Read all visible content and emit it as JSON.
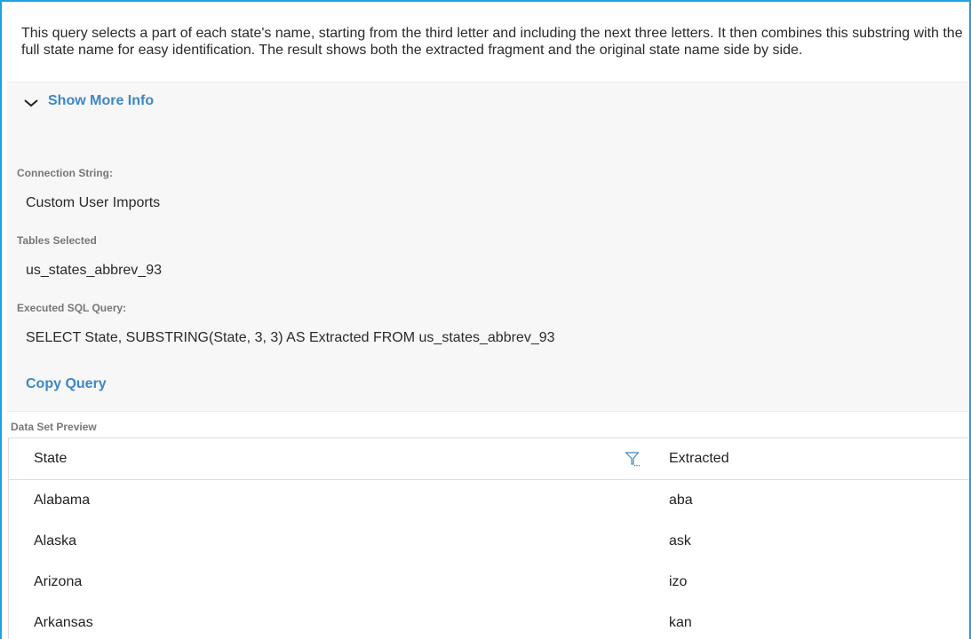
{
  "description": "This query selects a part of each state's name, starting from the third letter and including the next three letters. It then combines this substring with the full state name for easy identification. The result shows both the extracted fragment and the original state name side by side.",
  "info": {
    "toggle_label": "Show More Info",
    "connection_label": "Connection String:",
    "connection_value": "Custom User Imports",
    "tables_label": "Tables Selected",
    "tables_value": "us_states_abbrev_93",
    "sql_label": "Executed SQL Query:",
    "sql_value": "SELECT State, SUBSTRING(State, 3, 3) AS Extracted FROM us_states_abbrev_93",
    "copy_label": "Copy Query"
  },
  "preview": {
    "label": "Data Set Preview",
    "columns": [
      "State",
      "Extracted"
    ],
    "rows": [
      [
        "Alabama",
        "aba"
      ],
      [
        "Alaska",
        "ask"
      ],
      [
        "Arizona",
        "izo"
      ],
      [
        "Arkansas",
        "kan"
      ]
    ]
  },
  "colors": {
    "accent": "#3f86c6",
    "frame": "#1aa3e0",
    "panel_bg": "#f7f7f7"
  },
  "icons": {
    "toggle": "chevron-down-icon",
    "filter": "filter-icon"
  }
}
